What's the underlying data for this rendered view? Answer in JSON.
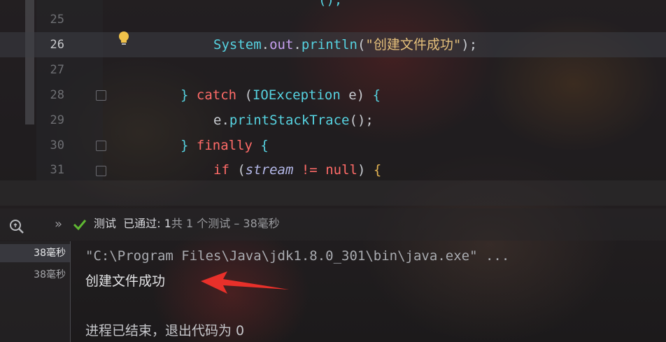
{
  "editor": {
    "lines": [
      {
        "num": "25",
        "code": ""
      },
      {
        "num": "26",
        "code_parts": [
          "System",
          ".",
          "out",
          ".",
          "println",
          "(",
          "\"创建文件成功\"",
          ");"
        ]
      },
      {
        "num": "27",
        "code": ""
      },
      {
        "num": "28",
        "code_parts": [
          "}",
          " catch ",
          "(",
          "IOException",
          " e) ",
          "{"
        ]
      },
      {
        "num": "29",
        "code_parts": [
          "e",
          ".",
          "printStackTrace",
          "();"
        ]
      },
      {
        "num": "30",
        "code_parts": [
          "}",
          " finally ",
          "{"
        ]
      },
      {
        "num": "31",
        "code_parts": [
          "if",
          " (",
          "stream",
          " != ",
          "null",
          ") ",
          "{"
        ]
      }
    ],
    "partial_top": "();"
  },
  "test_bar": {
    "status_label": "测试",
    "passed_label": "已通过:",
    "passed_count": "1",
    "summary": "共 1 个测试 – 38毫秒"
  },
  "console": {
    "times": [
      "38毫秒",
      "38毫秒"
    ],
    "command": "\"C:\\Program Files\\Java\\jdk1.8.0_301\\bin\\java.exe\" ...",
    "output": "创建文件成功",
    "exit_message": "进程已结束，退出代码为 0"
  }
}
